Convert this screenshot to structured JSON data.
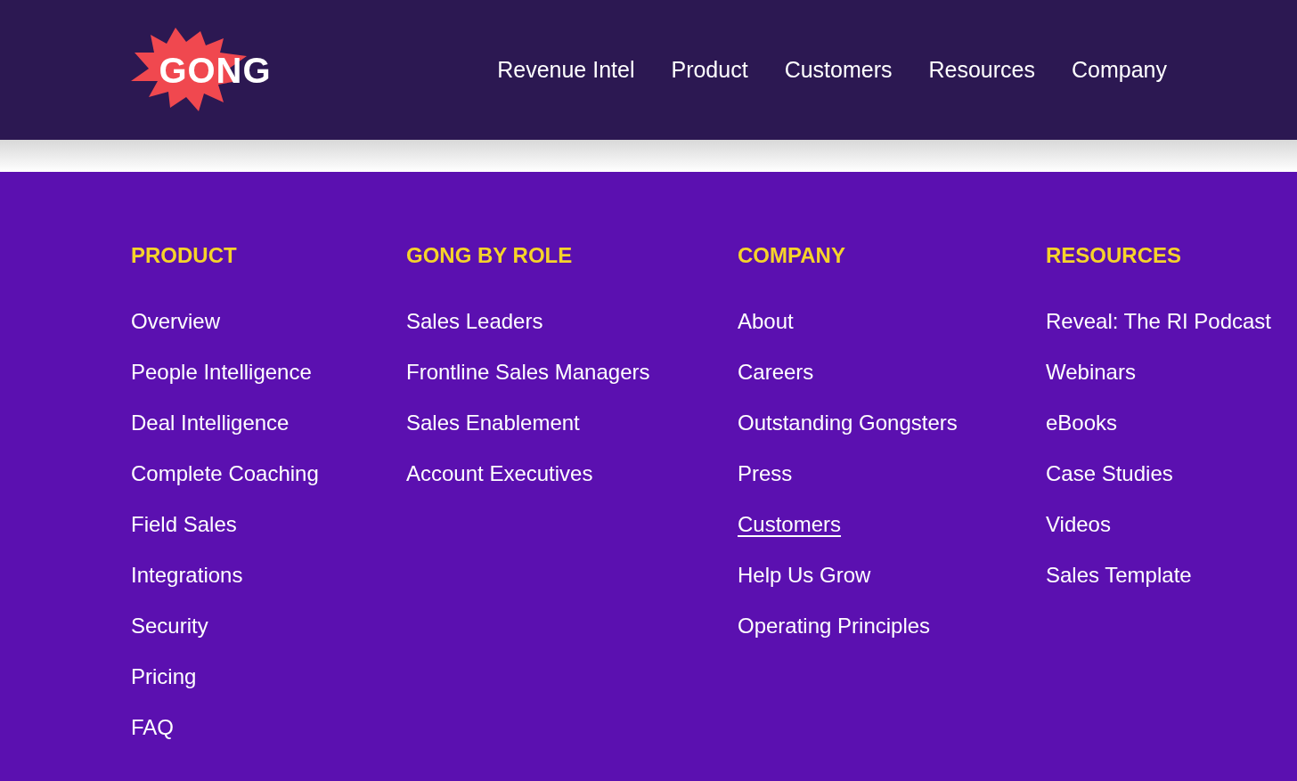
{
  "header": {
    "logo": "GONG",
    "nav": [
      "Revenue Intel",
      "Product",
      "Customers",
      "Resources",
      "Company"
    ]
  },
  "footer": {
    "columns": [
      {
        "heading": "PRODUCT",
        "links": [
          {
            "label": "Overview",
            "underlined": false
          },
          {
            "label": "People Intelligence",
            "underlined": false
          },
          {
            "label": "Deal Intelligence",
            "underlined": false
          },
          {
            "label": "Complete Coaching",
            "underlined": false
          },
          {
            "label": "Field Sales",
            "underlined": false
          },
          {
            "label": "Integrations",
            "underlined": false
          },
          {
            "label": "Security",
            "underlined": false
          },
          {
            "label": "Pricing",
            "underlined": false
          },
          {
            "label": "FAQ",
            "underlined": false
          }
        ]
      },
      {
        "heading": "GONG BY ROLE",
        "links": [
          {
            "label": "Sales Leaders",
            "underlined": false
          },
          {
            "label": "Frontline Sales Managers",
            "underlined": false
          },
          {
            "label": "Sales Enablement",
            "underlined": false
          },
          {
            "label": "Account Executives",
            "underlined": false
          }
        ]
      },
      {
        "heading": "COMPANY",
        "links": [
          {
            "label": "About",
            "underlined": false
          },
          {
            "label": "Careers",
            "underlined": false
          },
          {
            "label": "Outstanding Gongsters",
            "underlined": false
          },
          {
            "label": "Press",
            "underlined": false
          },
          {
            "label": "Customers",
            "underlined": true
          },
          {
            "label": "Help Us Grow",
            "underlined": false
          },
          {
            "label": "Operating Principles",
            "underlined": false
          }
        ]
      },
      {
        "heading": "RESOURCES",
        "links": [
          {
            "label": "Reveal: The RI Podcast",
            "underlined": false
          },
          {
            "label": "Webinars",
            "underlined": false
          },
          {
            "label": "eBooks",
            "underlined": false
          },
          {
            "label": "Case Studies",
            "underlined": false
          },
          {
            "label": "Videos",
            "underlined": false
          },
          {
            "label": "Sales Template",
            "underlined": false
          }
        ]
      }
    ]
  }
}
